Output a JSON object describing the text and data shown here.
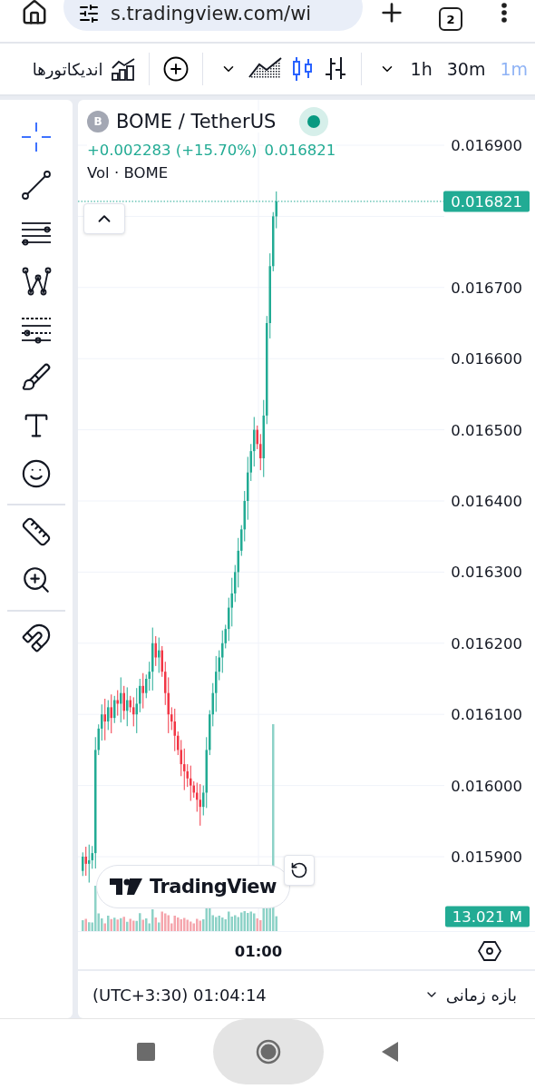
{
  "browser": {
    "url": "s.tradingview.com/wi",
    "tab_count": "2"
  },
  "toolbar": {
    "indicators_label": "اندیکاتورها",
    "chart_types": [
      {
        "kind": "area",
        "selected": false
      },
      {
        "kind": "candles",
        "selected": true
      },
      {
        "kind": "bars",
        "selected": false
      }
    ],
    "intervals": [
      {
        "label": "1h",
        "selected": false
      },
      {
        "label": "30m",
        "selected": false
      },
      {
        "label": "1m",
        "selected": true
      }
    ]
  },
  "tool_groups": [
    {
      "tools": [
        {
          "kind": "crosshair",
          "selected": true
        },
        {
          "kind": "trend-line",
          "selected": false
        },
        {
          "kind": "fib",
          "selected": false
        },
        {
          "kind": "pattern",
          "selected": false
        },
        {
          "kind": "projection",
          "selected": false
        },
        {
          "kind": "brush",
          "selected": false
        },
        {
          "kind": "text",
          "selected": false
        },
        {
          "kind": "emoji",
          "selected": false
        }
      ]
    },
    {
      "tools": [
        {
          "kind": "ruler",
          "selected": false
        },
        {
          "kind": "zoom",
          "selected": false
        }
      ]
    },
    {
      "tools": [
        {
          "kind": "magnet",
          "selected": false
        }
      ]
    }
  ],
  "legend": {
    "symbol_badge": "B",
    "symbol": "BOME / TetherUS",
    "market_open": true,
    "change": "+0.002283 (+15.70%)",
    "last": "0.016821",
    "volume_label": "Vol · BOME"
  },
  "logo_text": "TradingView",
  "price_axis": {
    "top_label": "0.016900",
    "labels": [
      "0.016700",
      "0.016600",
      "0.016500",
      "0.016400",
      "0.016300",
      "0.016200",
      "0.016100",
      "0.016000",
      "0.015900"
    ],
    "last_price_tag": "0.016821",
    "volume_tag": "13.021 M"
  },
  "time_axis": {
    "labels": [
      "01:00"
    ]
  },
  "bottom_bar": {
    "clock": "(UTC+3:30) 01:04:14",
    "range_label": "بازه زمانی"
  }
}
